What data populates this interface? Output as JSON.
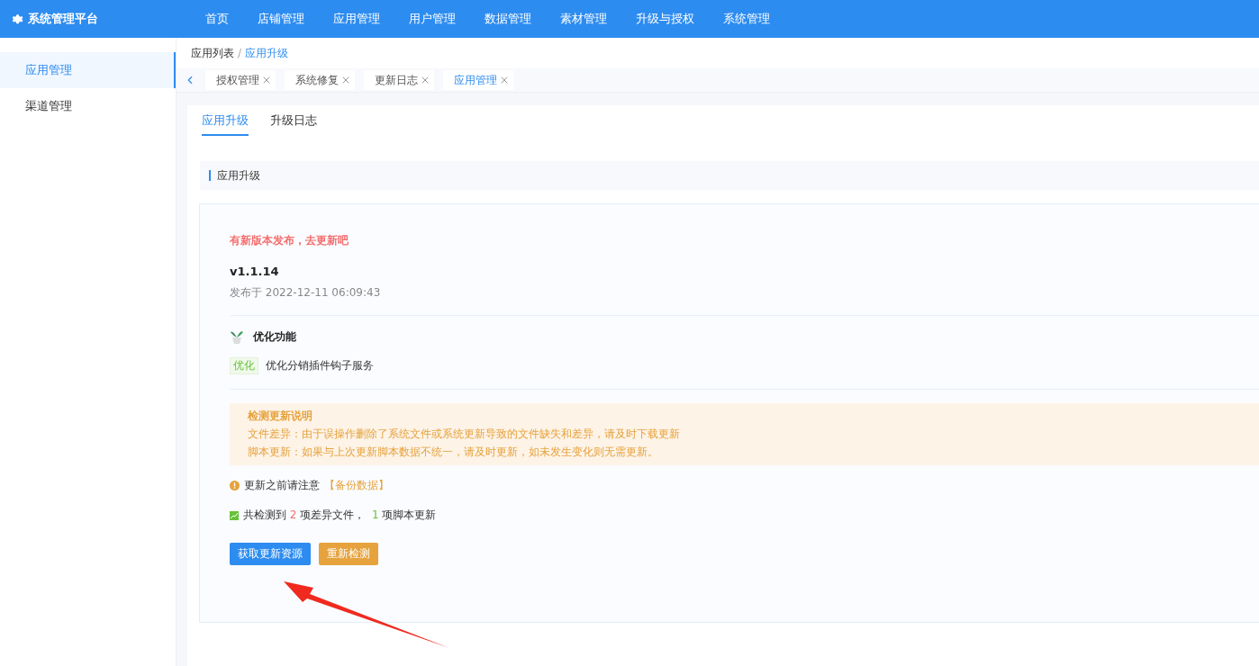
{
  "header": {
    "title": "系统管理平台",
    "nav": [
      {
        "label": "首页"
      },
      {
        "label": "店铺管理"
      },
      {
        "label": "应用管理"
      },
      {
        "label": "用户管理"
      },
      {
        "label": "数据管理"
      },
      {
        "label": "素材管理"
      },
      {
        "label": "升级与授权"
      },
      {
        "label": "系统管理"
      }
    ]
  },
  "sidebar": {
    "items": [
      {
        "label": "应用管理",
        "selected": true
      },
      {
        "label": "渠道管理",
        "selected": false
      }
    ]
  },
  "breadcrumb": {
    "items": [
      "应用列表",
      "应用升级"
    ],
    "separator": "/"
  },
  "page_tabs": [
    {
      "label": "授权管理",
      "selected": false
    },
    {
      "label": "系统修复",
      "selected": false
    },
    {
      "label": "更新日志",
      "selected": false
    },
    {
      "label": "应用管理",
      "selected": true
    }
  ],
  "sub_tabs": [
    {
      "label": "应用升级",
      "selected": true
    },
    {
      "label": "升级日志",
      "selected": false
    }
  ],
  "section_title": "应用升级",
  "update": {
    "notice": "有新版本发布，去更新吧",
    "version": "v1.1.14",
    "released": "发布于 2022-12-11 06:09:43",
    "feature_heading": "优化功能",
    "changes": [
      {
        "tag": "优化",
        "text": "优化分销插件钩子服务"
      }
    ],
    "alert": {
      "title": "检测更新说明",
      "lines": [
        "文件差异：由于误操作删除了系统文件或系统更新导致的文件缺失和差异，请及时下载更新",
        "脚本更新：如果与上次更新脚本数据不统一，请及时更新，如未发生变化则无需更新。"
      ]
    },
    "warning": {
      "text": "更新之前请注意",
      "link": "【备份数据】"
    },
    "summary": {
      "prefix": "共检测到",
      "diff_count": "2",
      "middle": "项差异文件，",
      "script_count": "1",
      "suffix": "项脚本更新"
    },
    "buttons": [
      {
        "label": "获取更新资源",
        "kind": "primary"
      },
      {
        "label": "重新检测",
        "kind": "warning"
      }
    ]
  }
}
